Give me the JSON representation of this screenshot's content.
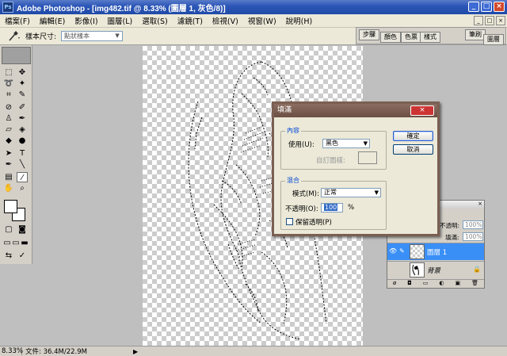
{
  "titlebar": {
    "logo": "Ps",
    "title": "Adobe Photoshop - [img482.tif @ 8.33% (圖層 1, 灰色/8)]",
    "minimize": "_",
    "maximize": "□",
    "close": "×"
  },
  "menu": {
    "items": [
      "檔案(F)",
      "編輯(E)",
      "影像(I)",
      "圖層(L)",
      "選取(S)",
      "濾鏡(T)",
      "檢視(V)",
      "視窗(W)",
      "說明(H)"
    ],
    "mdi_min": "_",
    "mdi_max": "□",
    "mdi_close": "×"
  },
  "options": {
    "tool_icon": "eyedropper-icon",
    "sample_label": "樣本尺寸:",
    "sample_value": "點狀樣本"
  },
  "palette_well": {
    "tabs": [
      "步驟",
      "顏色",
      "色票",
      "樣式",
      "筆刷",
      "圖層"
    ]
  },
  "toolbox": {
    "text_tool": "T"
  },
  "fill_dialog": {
    "title": "填滿",
    "close": "×",
    "contents_group": "內容",
    "use_label": "使用(U):",
    "use_value": "黑色",
    "custom_pattern_label": "自訂圖樣:",
    "blending_group": "混合",
    "mode_label": "模式(M):",
    "mode_value": "正常",
    "opacity_label": "不透明(O):",
    "opacity_value": "100",
    "opacity_unit": "%",
    "preserve_label": "保留透明(P)",
    "preserve_checked": false,
    "ok_label": "確定",
    "cancel_label": "取消"
  },
  "layers": {
    "opacity_label": "不透明:",
    "opacity_value": "100%",
    "fill_label": "填滿:",
    "fill_value": "100%",
    "rows": [
      {
        "name": "圖層 1",
        "selected": true
      },
      {
        "name": "背景",
        "selected": false
      }
    ]
  },
  "statusbar": {
    "zoom": "8.33%",
    "doc_info": "文件: 36.4M/22.9M",
    "play": "▶"
  }
}
